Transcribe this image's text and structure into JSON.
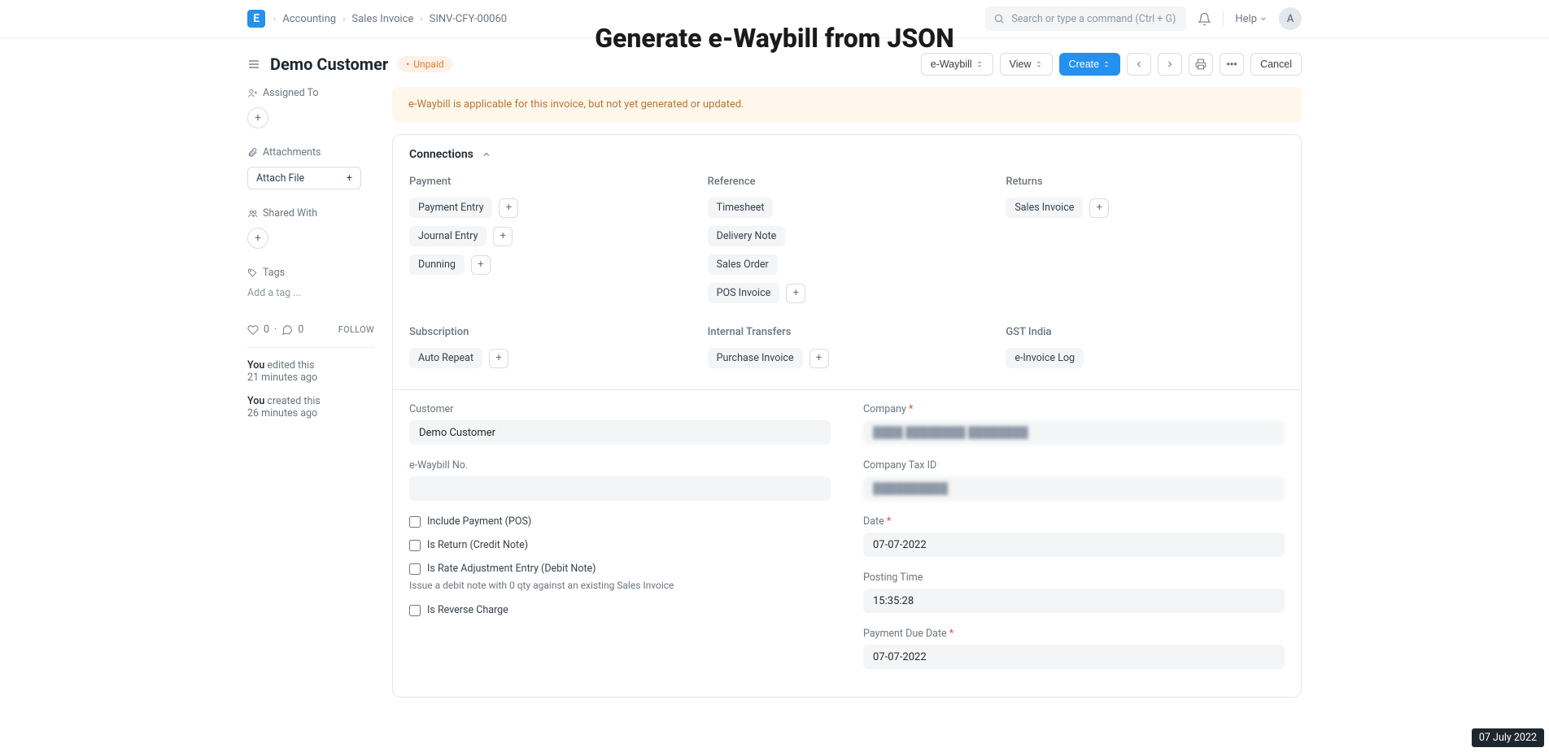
{
  "overlayTitle": "Generate e-Waybill from JSON",
  "nav": {
    "brandLetter": "E",
    "breadcrumb": [
      "Accounting",
      "Sales Invoice",
      "SINV-CFY-00060"
    ],
    "searchPlaceholder": "Search or type a command (Ctrl + G)",
    "help": "Help",
    "avatarInitial": "A"
  },
  "header": {
    "title": "Demo Customer",
    "status": "Unpaid",
    "actions": {
      "ewaybill": "e-Waybill",
      "view": "View",
      "create": "Create",
      "cancel": "Cancel"
    }
  },
  "sidebar": {
    "assignedTo": "Assigned To",
    "attachments": "Attachments",
    "attachFile": "Attach File",
    "sharedWith": "Shared With",
    "tags": "Tags",
    "addTag": "Add a tag ...",
    "likes": "0",
    "comments": "0",
    "follow": "FOLLOW",
    "history": [
      {
        "user": "You",
        "action": "edited this",
        "time": "21 minutes ago"
      },
      {
        "user": "You",
        "action": "created this",
        "time": "26 minutes ago"
      }
    ]
  },
  "alert": "e-Waybill is applicable for this invoice, but not yet generated or updated.",
  "connections": {
    "title": "Connections",
    "groups": [
      {
        "title": "Payment",
        "items": [
          {
            "label": "Payment Entry",
            "add": true
          },
          {
            "label": "Journal Entry",
            "add": true
          },
          {
            "label": "Dunning",
            "add": true
          }
        ]
      },
      {
        "title": "Reference",
        "items": [
          {
            "label": "Timesheet",
            "add": false
          },
          {
            "label": "Delivery Note",
            "add": false
          },
          {
            "label": "Sales Order",
            "add": false
          },
          {
            "label": "POS Invoice",
            "add": true
          }
        ]
      },
      {
        "title": "Returns",
        "items": [
          {
            "label": "Sales Invoice",
            "add": true
          }
        ]
      },
      {
        "title": "Subscription",
        "items": [
          {
            "label": "Auto Repeat",
            "add": true
          }
        ]
      },
      {
        "title": "Internal Transfers",
        "items": [
          {
            "label": "Purchase Invoice",
            "add": true
          }
        ]
      },
      {
        "title": "GST India",
        "items": [
          {
            "label": "e-Invoice Log",
            "add": false
          }
        ]
      }
    ]
  },
  "form": {
    "customer": {
      "label": "Customer",
      "value": "Demo Customer"
    },
    "ewaybillNo": {
      "label": "e-Waybill No.",
      "value": ""
    },
    "includePayment": {
      "label": "Include Payment (POS)"
    },
    "isReturn": {
      "label": "Is Return (Credit Note)"
    },
    "isRateAdjustment": {
      "label": "Is Rate Adjustment Entry (Debit Note)",
      "helper": "Issue a debit note with 0 qty against an existing Sales Invoice"
    },
    "isReverseCharge": {
      "label": "Is Reverse Charge"
    },
    "company": {
      "label": "Company",
      "value": "████ ████████ ████████"
    },
    "companyTaxId": {
      "label": "Company Tax ID",
      "value": "██████████"
    },
    "date": {
      "label": "Date",
      "value": "07-07-2022"
    },
    "postingTime": {
      "label": "Posting Time",
      "value": "15:35:28"
    },
    "paymentDueDate": {
      "label": "Payment Due Date",
      "value": "07-07-2022"
    }
  },
  "dateBadge": "07 July 2022"
}
